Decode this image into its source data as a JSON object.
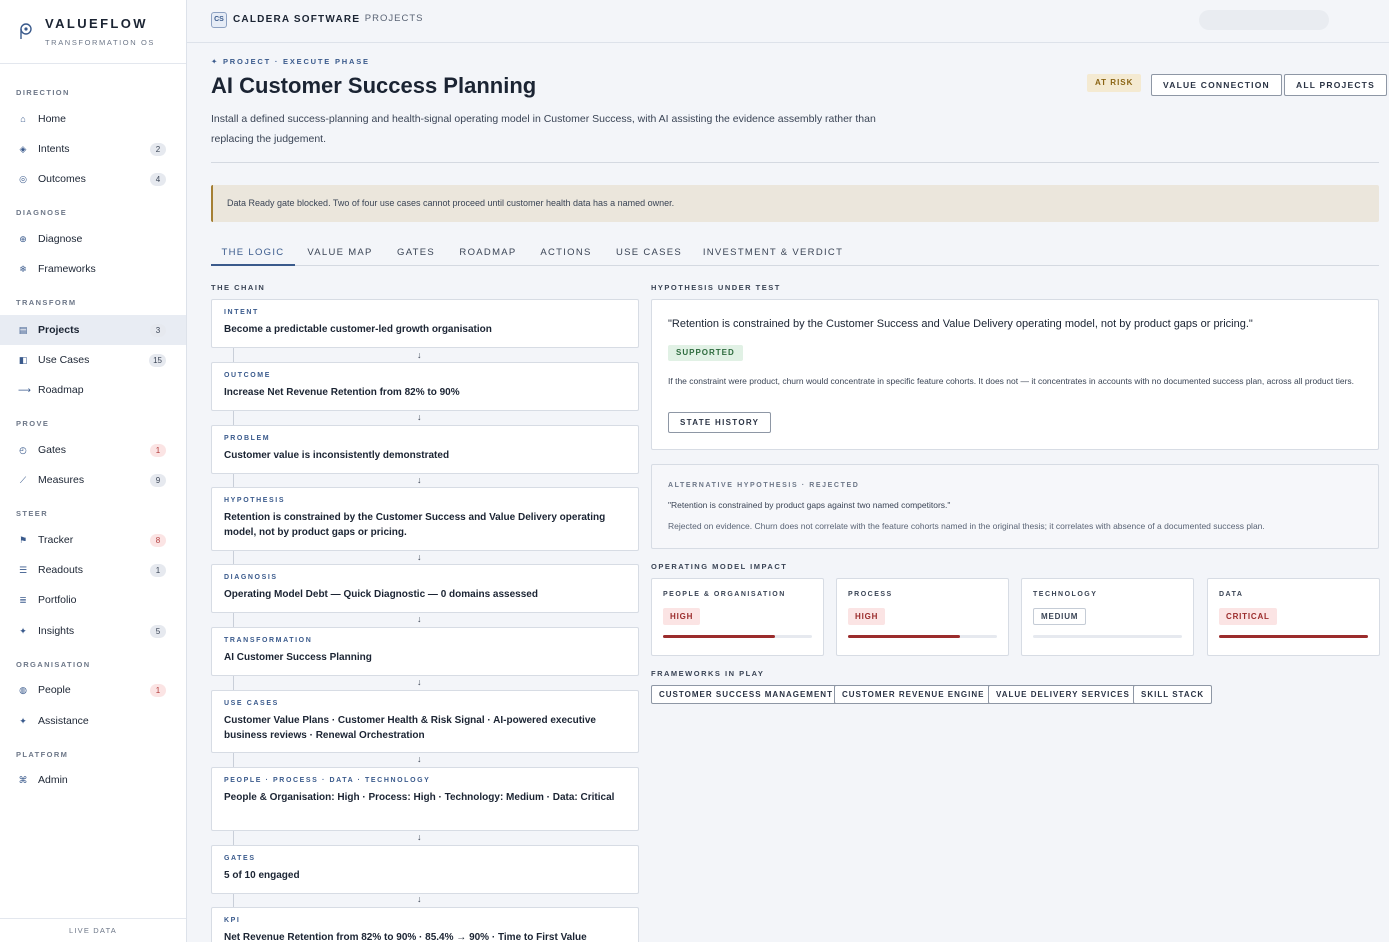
{
  "brand": {
    "name": "VALUEFLOW",
    "subtitle": "TRANSFORMATION OS",
    "logo_icon": "p-logo-icon"
  },
  "sidebar": {
    "sections": [
      {
        "label": "DIRECTION",
        "items": [
          {
            "label": "Home",
            "icon": "home-icon",
            "badge": ""
          },
          {
            "label": "Intents",
            "icon": "diamond-icon",
            "badge": "2"
          },
          {
            "label": "Outcomes",
            "icon": "target-icon",
            "badge": "4"
          }
        ]
      },
      {
        "label": "DIAGNOSE",
        "items": [
          {
            "label": "Diagnose",
            "icon": "crosshair-icon",
            "badge": ""
          },
          {
            "label": "Frameworks",
            "icon": "snowflake-icon",
            "badge": ""
          }
        ]
      },
      {
        "label": "TRANSFORM",
        "items": [
          {
            "label": "Projects",
            "icon": "square-icon",
            "badge": "3",
            "active": true
          },
          {
            "label": "Use Cases",
            "icon": "half-square-icon",
            "badge": "15"
          },
          {
            "label": "Roadmap",
            "icon": "arrow-right-icon",
            "badge": ""
          }
        ]
      },
      {
        "label": "PROVE",
        "items": [
          {
            "label": "Gates",
            "icon": "gauge-icon",
            "badge": "1",
            "badge_color": "red"
          },
          {
            "label": "Measures",
            "icon": "trend-icon",
            "badge": "9"
          }
        ]
      },
      {
        "label": "STEER",
        "items": [
          {
            "label": "Tracker",
            "icon": "flag-icon",
            "badge": "8",
            "badge_color": "red"
          },
          {
            "label": "Readouts",
            "icon": "list-icon",
            "badge": "1"
          },
          {
            "label": "Portfolio",
            "icon": "stack-icon",
            "badge": ""
          },
          {
            "label": "Insights",
            "icon": "sparkle-icon",
            "badge": "5"
          }
        ]
      },
      {
        "label": "ORGANISATION",
        "items": [
          {
            "label": "People",
            "icon": "person-icon",
            "badge": "1",
            "badge_color": "red"
          },
          {
            "label": "Assistance",
            "icon": "star-icon",
            "badge": ""
          }
        ]
      },
      {
        "label": "PLATFORM",
        "items": [
          {
            "label": "Admin",
            "icon": "command-icon",
            "badge": ""
          }
        ]
      }
    ],
    "footer": "LIVE DATA"
  },
  "topbar": {
    "org_initials": "CS",
    "org_name": "CALDERA SOFTWARE",
    "breadcrumb": "· PROJECTS"
  },
  "page": {
    "eyebrow": "✦ PROJECT · EXECUTE PHASE",
    "title": "AI Customer Success Planning",
    "description": "Install a defined success-planning and health-signal operating model in Customer Success, with AI assisting the evidence assembly rather than replacing the judgement.",
    "status_badge": "AT RISK",
    "buttons": {
      "value_connection": "VALUE CONNECTION",
      "all_projects": "ALL PROJECTS"
    },
    "alert": "Data Ready gate blocked. Two of four use cases cannot proceed until customer health data has a named owner.",
    "tabs": [
      "THE LOGIC",
      "VALUE MAP",
      "GATES",
      "ROADMAP",
      "ACTIONS",
      "USE CASES",
      "INVESTMENT & VERDICT"
    ],
    "active_tab": "THE LOGIC"
  },
  "chain": {
    "label": "THE CHAIN",
    "items": [
      {
        "kind": "INTENT",
        "value": "Become a predictable customer-led growth organisation"
      },
      {
        "kind": "OUTCOME",
        "value": "Increase Net Revenue Retention from 82% to 90%"
      },
      {
        "kind": "PROBLEM",
        "value": "Customer value is inconsistently demonstrated"
      },
      {
        "kind": "HYPOTHESIS",
        "value": "Retention is constrained by the Customer Success and Value Delivery operating model, not by product gaps or pricing."
      },
      {
        "kind": "DIAGNOSIS",
        "value": "Operating Model Debt — Quick Diagnostic — 0 domains assessed"
      },
      {
        "kind": "TRANSFORMATION",
        "value": "AI Customer Success Planning"
      },
      {
        "kind": "USE CASES",
        "value": "Customer Value Plans · Customer Health & Risk Signal · AI-powered executive business reviews · Renewal Orchestration"
      },
      {
        "kind": "PEOPLE · PROCESS · DATA · TECHNOLOGY",
        "value": "People & Organisation: High · Process: High · Technology: Medium · Data: Critical"
      },
      {
        "kind": "GATES",
        "value": "5 of 10 engaged"
      },
      {
        "kind": "KPI",
        "value": "Net Revenue Retention from 82% to 90% · 85.4% → 90% · Time to First Value"
      }
    ],
    "arrow": "↓"
  },
  "hypothesis": {
    "label": "HYPOTHESIS UNDER TEST",
    "quote": "\"Retention is constrained by the Customer Success and Value Delivery operating model, not by product gaps or pricing.\"",
    "status": "SUPPORTED",
    "evidence": "If the constraint were product, churn would concentrate in specific feature cohorts. It does not — it concentrates in accounts with no documented success plan, across all product tiers.",
    "state_history_button": "STATE HISTORY"
  },
  "alternative": {
    "label": "ALTERNATIVE HYPOTHESIS · REJECTED",
    "quote": "\"Retention is constrained by product gaps against two named competitors.\"",
    "reason": "Rejected on evidence. Churn does not correlate with the feature cohorts named in the original thesis; it correlates with absence of a documented success plan."
  },
  "impact": {
    "label": "OPERATING MODEL IMPACT",
    "items": [
      {
        "label": "PEOPLE & ORGANISATION",
        "level": "HIGH",
        "kind": "high",
        "fill_percent": 75
      },
      {
        "label": "PROCESS",
        "level": "HIGH",
        "kind": "high",
        "fill_percent": 75
      },
      {
        "label": "TECHNOLOGY",
        "level": "MEDIUM",
        "kind": "medium",
        "fill_percent": 0
      },
      {
        "label": "DATA",
        "level": "CRITICAL",
        "kind": "critical",
        "fill_percent": 100
      }
    ]
  },
  "frameworks": {
    "label": "FRAMEWORKS IN PLAY",
    "items": [
      "CUSTOMER SUCCESS MANAGEMENT",
      "CUSTOMER REVENUE ENGINE",
      "VALUE DELIVERY SERVICES",
      "SKILL STACK"
    ]
  },
  "colors": {
    "accent": "#3a5a8c",
    "risk_bg": "#f4ead2",
    "risk_text": "#8a6414",
    "critical": "#9b2c2c",
    "supported_bg": "#e1f1e5"
  }
}
